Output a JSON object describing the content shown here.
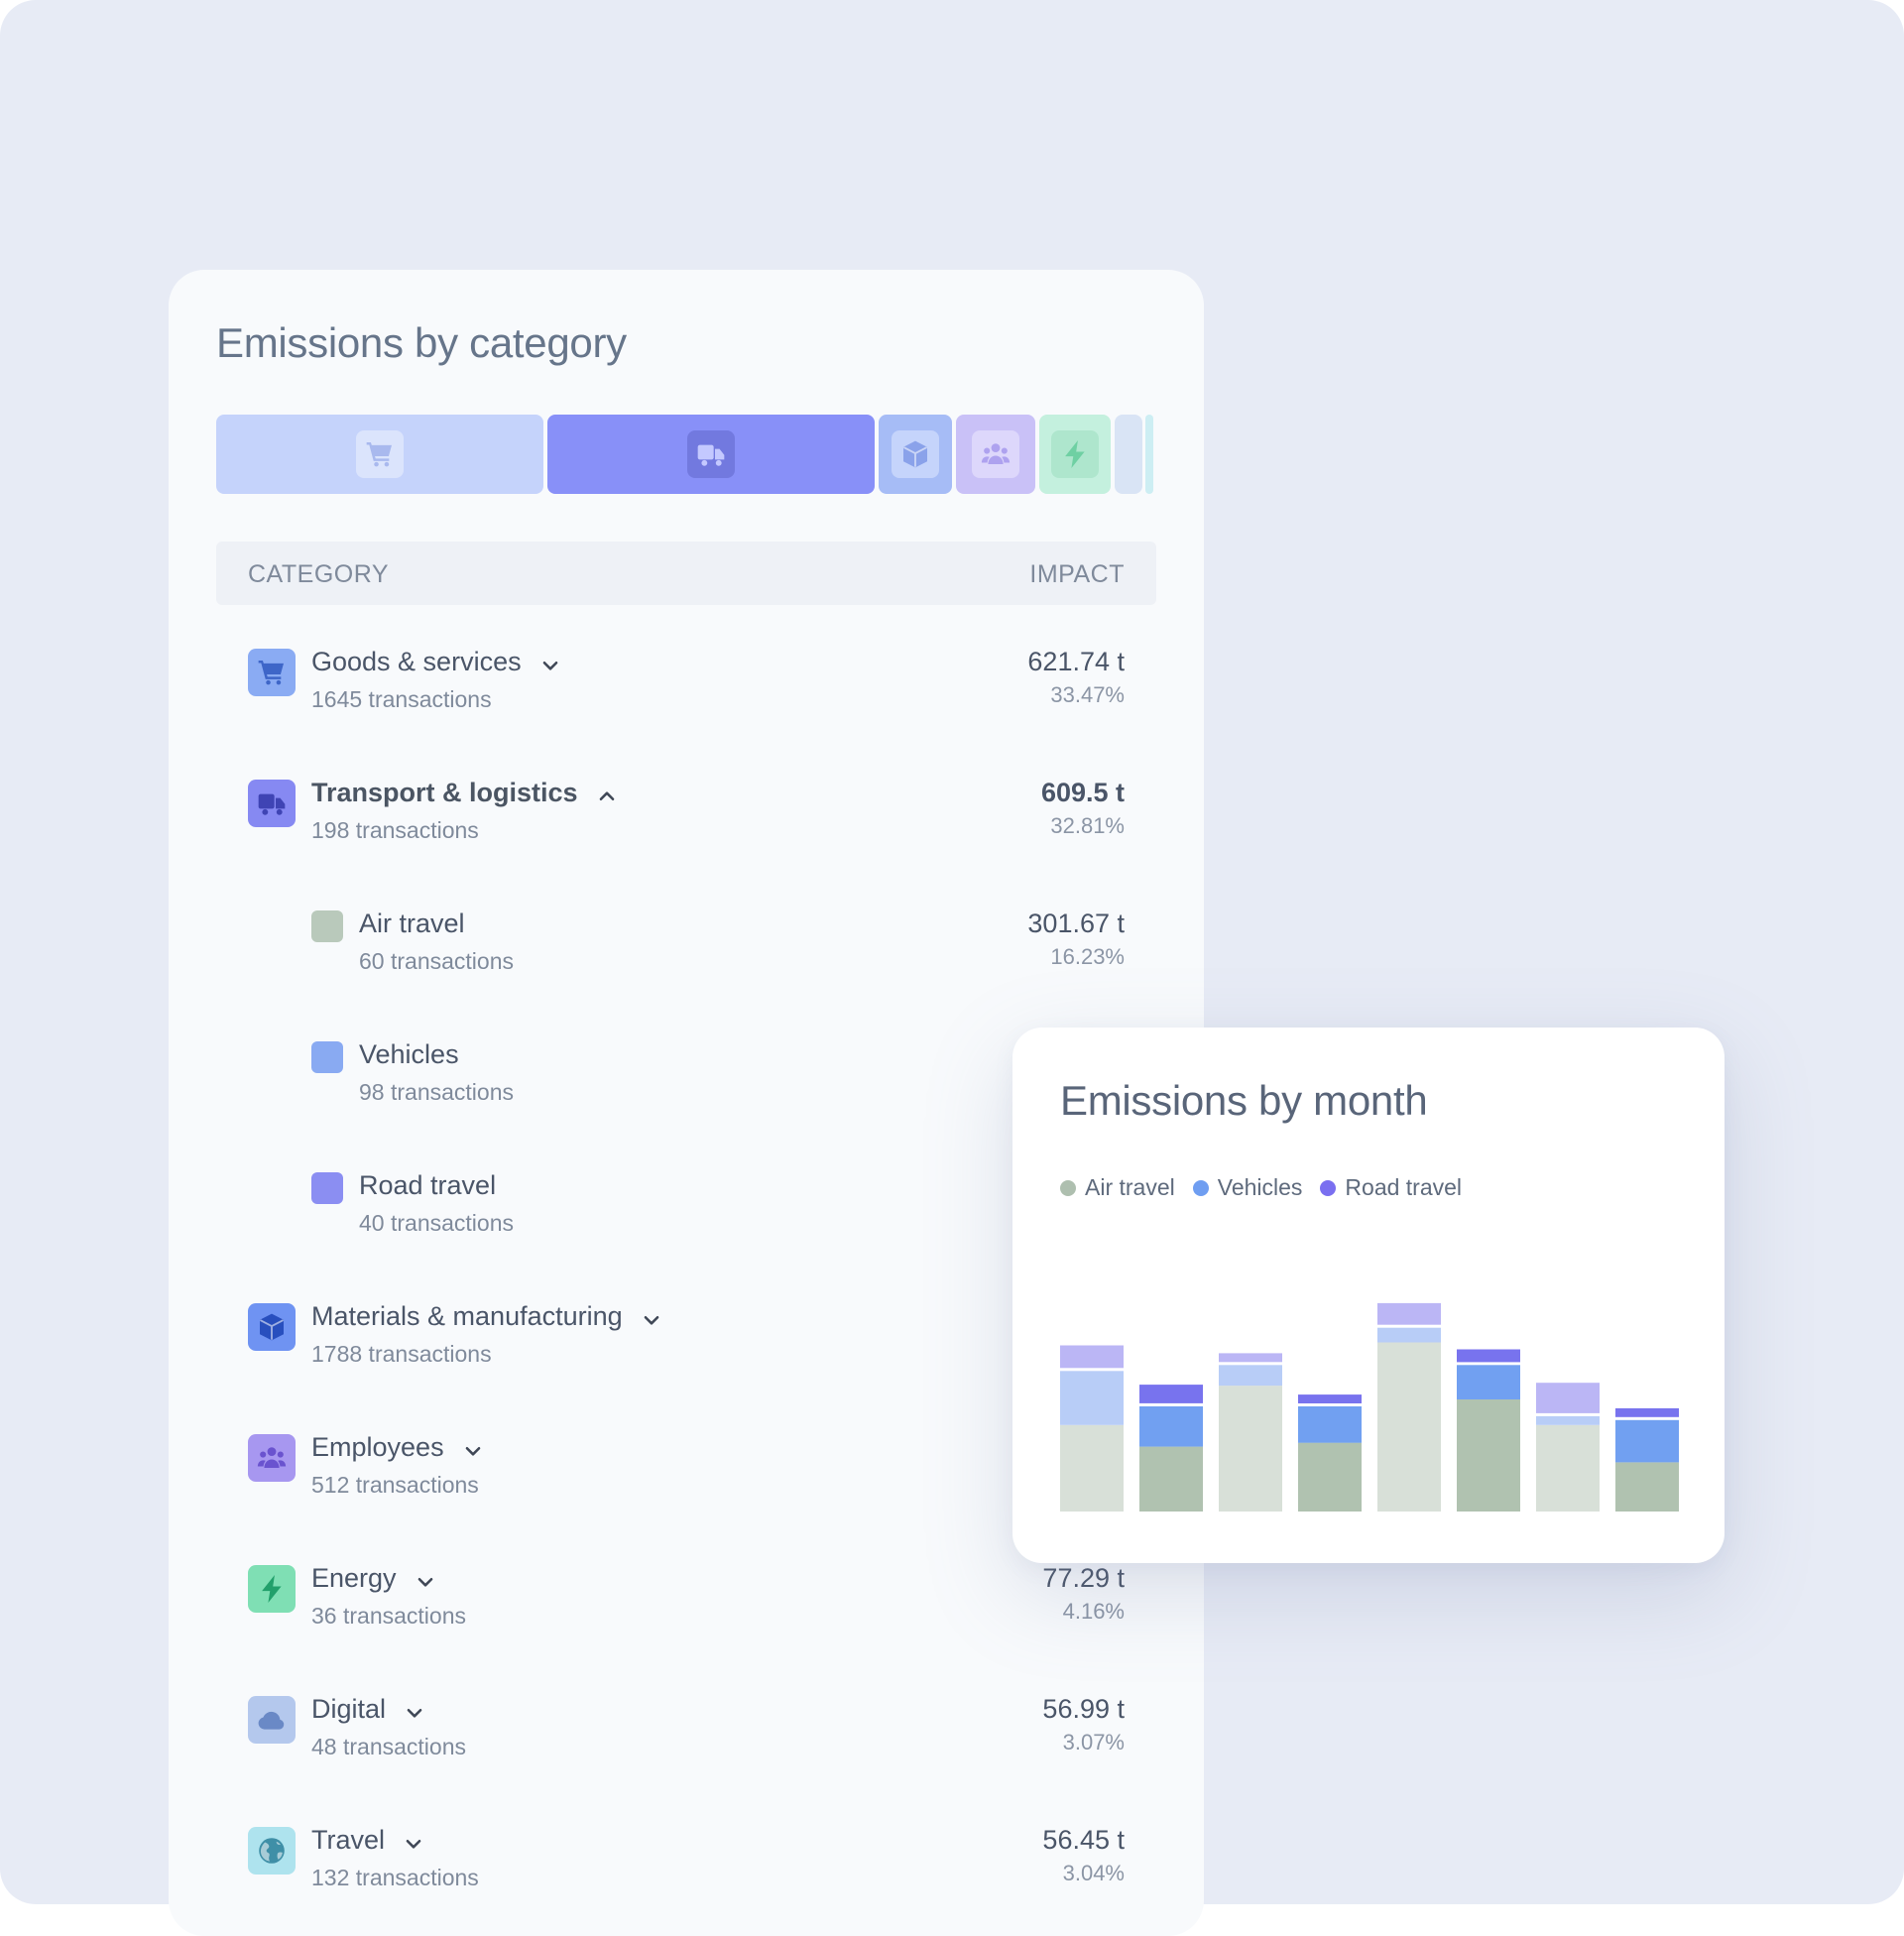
{
  "category_panel": {
    "title": "Emissions by category",
    "bar_segments": [
      {
        "icon": "cart-icon",
        "share_percent": 33.47,
        "color": "#c5d3fb",
        "icon_bg": "#dbe4fc",
        "icon_color": "#a9b9ee"
      },
      {
        "icon": "truck-icon",
        "share_percent": 32.81,
        "color": "#8890f8",
        "icon_bg": "#7279df",
        "icon_color": "#c4c9ff"
      },
      {
        "icon": "box-icon",
        "color": "#a6bcf6",
        "icon_bg": "#c5d4fb",
        "icon_color": "#8aa2ea"
      },
      {
        "icon": "users-icon",
        "color": "#c9c1f7",
        "icon_bg": "#ddd7fb",
        "icon_color": "#aea2ef"
      },
      {
        "icon": "bolt-icon",
        "share_percent": 4.16,
        "color": "#c4f0de",
        "icon_bg": "#aee6cd",
        "icon_color": "#6fd0a3"
      },
      {
        "icon": null,
        "share_percent": 3.07,
        "color": "#d9e4f5"
      },
      {
        "icon": null,
        "share_percent": 3.04,
        "color": "#cdeef3"
      }
    ],
    "table": {
      "header_category": "CATEGORY",
      "header_impact": "IMPACT"
    },
    "rows": [
      {
        "name": "Goods & services",
        "count": "1645 transactions",
        "impact": "621.74 t",
        "percent": "33.47%",
        "icon": "cart-icon",
        "expanded": false
      },
      {
        "name": "Transport & logistics",
        "count": "198 transactions",
        "impact": "609.5 t",
        "percent": "32.81%",
        "icon": "truck-icon",
        "expanded": true
      },
      {
        "name": "Air travel",
        "count": "60 transactions",
        "impact": "301.67 t",
        "percent": "16.23%",
        "color": "#b9c9bb"
      },
      {
        "name": "Vehicles",
        "count": "98 transactions",
        "color": "#89aaf2"
      },
      {
        "name": "Road travel",
        "count": "40 transactions",
        "color": "#8b8ef2"
      },
      {
        "name": "Materials & manufacturing",
        "count": "1788 transactions",
        "icon": "box-icon",
        "expanded": false
      },
      {
        "name": "Employees",
        "count": "512 transactions",
        "icon": "users-icon",
        "expanded": false
      },
      {
        "name": "Energy",
        "count": "36 transactions",
        "impact": "77.29 t",
        "percent": "4.16%",
        "icon": "bolt-icon",
        "expanded": false
      },
      {
        "name": "Digital",
        "count": "48 transactions",
        "impact": "56.99 t",
        "percent": "3.07%",
        "icon": "cloud-icon",
        "expanded": false
      },
      {
        "name": "Travel",
        "count": "132 transactions",
        "impact": "56.45 t",
        "percent": "3.04%",
        "icon": "globe-icon",
        "expanded": false
      }
    ]
  },
  "month_card": {
    "title": "Emissions by month",
    "legend": [
      {
        "label": "Air travel",
        "color": "#aebfaf"
      },
      {
        "label": "Vehicles",
        "color": "#6f9ef1"
      },
      {
        "label": "Road travel",
        "color": "#7a6ff0"
      }
    ]
  },
  "chart_data": {
    "type": "bar",
    "stacked": true,
    "highlighted_bars": [
      1,
      3,
      5,
      7
    ],
    "series": [
      {
        "values": [
          88,
          66,
          128,
          70,
          172,
          114,
          88,
          50
        ],
        "colors": [
          "#d8e0d8",
          "#b0c2b0"
        ]
      },
      {
        "values": [
          58,
          44,
          24,
          40,
          18,
          38,
          12,
          46
        ],
        "colors": [
          "#b8cdf7",
          "#71a0f1"
        ]
      },
      {
        "values": [
          26,
          22,
          12,
          12,
          25,
          16,
          34,
          12
        ],
        "colors": [
          "#bbb6f5",
          "#7873ee"
        ]
      }
    ],
    "ylim": [
      0,
      230
    ]
  }
}
